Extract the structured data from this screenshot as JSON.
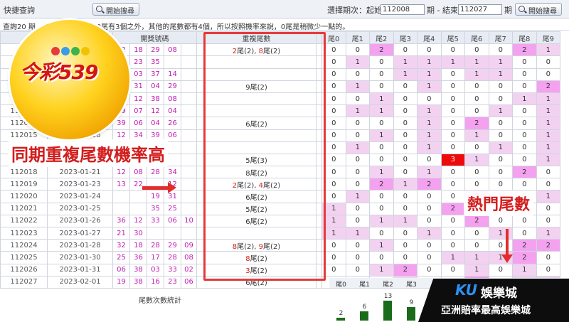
{
  "topbar": {
    "quick_search_label": "快捷查詢",
    "start_search_label": "開始搜尋",
    "period_label_prefix": "選擇期次：起始",
    "start_period": "112008",
    "period_end_label": "期 - 結束",
    "end_period": "112027",
    "period_suffix": "期",
    "start_search_label2": "開始搜尋"
  },
  "note": "查詢20 期，共 39個號碼，除0尾有3個之外，其他的尾數都有4個，所以按照機率來說，0尾是稍微少一點的。",
  "table": {
    "headers": {
      "number": "開獎號碼",
      "repeat": "重複尾數"
    },
    "tail_headers": [
      "尾0",
      "尾1",
      "尾2",
      "尾3",
      "尾4",
      "尾5",
      "尾6",
      "尾7",
      "尾8",
      "尾9"
    ],
    "rows": [
      {
        "id": "",
        "date": "",
        "nums": [
          "02",
          "18",
          "29",
          "08"
        ],
        "rep": [
          [
            "2",
            "尾(2), "
          ],
          [
            "8",
            "尾(2)"
          ]
        ],
        "tails": [
          "0",
          "0",
          "2",
          "0",
          "0",
          "0",
          "0",
          "0",
          "2",
          "1"
        ],
        "shade": [
          "",
          "",
          "pp",
          "",
          "",
          "",
          "",
          "",
          "pp",
          "p"
        ]
      },
      {
        "id": "",
        "date": "",
        "nums": [
          "31",
          "23",
          "35",
          ""
        ],
        "rep": [],
        "tails": [
          "0",
          "1",
          "0",
          "1",
          "1",
          "1",
          "1",
          "1",
          "0",
          "0"
        ],
        "shade": [
          "",
          "p",
          "",
          "p",
          "p",
          "p",
          "p",
          "p",
          "",
          ""
        ]
      },
      {
        "id": "",
        "date": "",
        "nums": [
          "26",
          "03",
          "37",
          "14"
        ],
        "rep": [],
        "tails": [
          "0",
          "0",
          "0",
          "1",
          "1",
          "0",
          "1",
          "1",
          "0",
          "0"
        ],
        "shade": [
          "",
          "",
          "",
          "p",
          "p",
          "",
          "p",
          "p",
          "",
          ""
        ]
      },
      {
        "id": "1",
        "date": "",
        "nums": [
          "09",
          "31",
          "04",
          "29"
        ],
        "rep": [
          [
            "",
            "9尾(2)"
          ]
        ],
        "tails": [
          "0",
          "1",
          "0",
          "0",
          "1",
          "0",
          "0",
          "0",
          "0",
          "2"
        ],
        "shade": [
          "",
          "p",
          "",
          "",
          "p",
          "",
          "",
          "",
          "",
          "pp"
        ]
      },
      {
        "id": "1",
        "date": "",
        "nums": [
          "29",
          "12",
          "38",
          "08"
        ],
        "rep": [],
        "tails": [
          "0",
          "0",
          "1",
          "0",
          "0",
          "0",
          "0",
          "0",
          "1",
          "1"
        ],
        "shade": [
          "",
          "",
          "p",
          "",
          "",
          "",
          "",
          "",
          "p",
          "p"
        ]
      },
      {
        "id": "112013",
        "date": "",
        "nums": [
          "29",
          "07",
          "12",
          "04"
        ],
        "rep": [],
        "tails": [
          "0",
          "1",
          "1",
          "0",
          "1",
          "0",
          "0",
          "1",
          "0",
          "1"
        ],
        "shade": [
          "",
          "p",
          "p",
          "",
          "p",
          "",
          "",
          "p",
          "",
          "p"
        ]
      },
      {
        "id": "112014",
        "date": "2023-01-17",
        "nums": [
          "39",
          "06",
          "04",
          "26"
        ],
        "rep": [
          [
            "",
            "6尾(2)"
          ]
        ],
        "tails": [
          "0",
          "0",
          "0",
          "0",
          "1",
          "0",
          "2",
          "0",
          "0",
          "1"
        ],
        "shade": [
          "",
          "",
          "",
          "",
          "p",
          "",
          "pp",
          "",
          "",
          "p"
        ]
      },
      {
        "id": "112015",
        "date": "2023-01-18",
        "nums": [
          "12",
          "34",
          "39",
          "06"
        ],
        "rep": [],
        "tails": [
          "0",
          "0",
          "1",
          "0",
          "1",
          "0",
          "1",
          "0",
          "0",
          "1"
        ],
        "shade": [
          "",
          "",
          "p",
          "",
          "p",
          "",
          "p",
          "",
          "",
          "p"
        ]
      },
      {
        "id": "",
        "date": "",
        "nums": [
          "",
          "",
          "",
          ""
        ],
        "rep": [],
        "tails": [
          "0",
          "1",
          "0",
          "0",
          "1",
          "0",
          "0",
          "1",
          "0",
          "1"
        ],
        "shade": [
          "",
          "p",
          "",
          "",
          "p",
          "",
          "",
          "p",
          "",
          "p"
        ]
      },
      {
        "id": "",
        "date": "",
        "nums": [
          "",
          "",
          "",
          ""
        ],
        "rep": [
          [
            "",
            "5尾(3)"
          ]
        ],
        "tails": [
          "0",
          "0",
          "0",
          "0",
          "0",
          "3",
          "1",
          "0",
          "0",
          "1"
        ],
        "shade": [
          "",
          "",
          "",
          "",
          "",
          "hot",
          "p",
          "",
          "",
          "p"
        ]
      },
      {
        "id": "112018",
        "date": "2023-01-21",
        "nums": [
          "12",
          "08",
          "28",
          "34"
        ],
        "rep": [
          [
            "",
            "8尾(2)"
          ]
        ],
        "tails": [
          "0",
          "0",
          "1",
          "0",
          "1",
          "0",
          "0",
          "0",
          "2",
          "0"
        ],
        "shade": [
          "",
          "",
          "p",
          "",
          "p",
          "",
          "",
          "",
          "pp",
          ""
        ]
      },
      {
        "id": "112019",
        "date": "2023-01-23",
        "nums": [
          "13",
          "22",
          "",
          "12"
        ],
        "rep": [
          [
            "2",
            "尾(2), "
          ],
          [
            "4",
            "尾(2)"
          ]
        ],
        "tails": [
          "0",
          "0",
          "2",
          "1",
          "2",
          "0",
          "0",
          "0",
          "0",
          "0"
        ],
        "shade": [
          "",
          "",
          "pp",
          "p",
          "pp",
          "",
          "",
          "",
          "",
          ""
        ]
      },
      {
        "id": "112020",
        "date": "2023-01-24",
        "nums": [
          "",
          "",
          "19",
          "31"
        ],
        "rep": [
          [
            "",
            "6尾(2)"
          ]
        ],
        "tails": [
          "0",
          "1",
          "0",
          "0",
          "0",
          "0",
          "2",
          "0",
          "0",
          "1"
        ],
        "shade": [
          "",
          "p",
          "",
          "",
          "",
          "",
          "pp",
          "",
          "",
          "p"
        ]
      },
      {
        "id": "112021",
        "date": "2023-01-25",
        "nums": [
          "",
          "",
          "35",
          "25"
        ],
        "rep": [
          [
            "",
            "5尾(2)"
          ]
        ],
        "tails": [
          "1",
          "0",
          "0",
          "0",
          "0",
          "2",
          "0",
          "1",
          "0",
          "0"
        ],
        "shade": [
          "p",
          "",
          "",
          "",
          "",
          "pp",
          "",
          "p",
          "",
          ""
        ]
      },
      {
        "id": "112022",
        "date": "2023-01-26",
        "nums": [
          "36",
          "12",
          "33",
          "06",
          "10"
        ],
        "rep": [
          [
            "",
            "6尾(2)"
          ]
        ],
        "tails": [
          "1",
          "0",
          "1",
          "1",
          "0",
          "0",
          "2",
          "0",
          "0",
          "0"
        ],
        "shade": [
          "p",
          "",
          "p",
          "p",
          "",
          "",
          "pp",
          "",
          "",
          ""
        ]
      },
      {
        "id": "112023",
        "date": "2023-01-27",
        "nums": [
          "21",
          "30",
          "",
          "",
          ""
        ],
        "rep": [],
        "tails": [
          "1",
          "1",
          "0",
          "0",
          "1",
          "0",
          "0",
          "1",
          "0",
          "1"
        ],
        "shade": [
          "p",
          "p",
          "",
          "",
          "p",
          "",
          "",
          "p",
          "",
          "p"
        ]
      },
      {
        "id": "112024",
        "date": "2023-01-28",
        "nums": [
          "32",
          "18",
          "28",
          "29",
          "09"
        ],
        "rep": [
          [
            "8",
            "尾(2), "
          ],
          [
            "9",
            "尾(2)"
          ]
        ],
        "tails": [
          "0",
          "0",
          "1",
          "0",
          "0",
          "0",
          "0",
          "0",
          "2",
          "2"
        ],
        "shade": [
          "",
          "",
          "p",
          "",
          "",
          "",
          "",
          "",
          "pp",
          "pp"
        ]
      },
      {
        "id": "112025",
        "date": "2023-01-30",
        "nums": [
          "25",
          "36",
          "17",
          "28",
          "08"
        ],
        "rep": [
          [
            "8",
            "尾(2)"
          ]
        ],
        "tails": [
          "0",
          "0",
          "0",
          "0",
          "0",
          "1",
          "1",
          "1",
          "2",
          "0"
        ],
        "shade": [
          "",
          "",
          "",
          "",
          "",
          "p",
          "p",
          "p",
          "pp",
          ""
        ]
      },
      {
        "id": "112026",
        "date": "2023-01-31",
        "nums": [
          "06",
          "38",
          "03",
          "33",
          "02"
        ],
        "rep": [
          [
            "3",
            "尾(2)"
          ]
        ],
        "tails": [
          "0",
          "0",
          "1",
          "2",
          "0",
          "0",
          "1",
          "0",
          "1",
          "0"
        ],
        "shade": [
          "",
          "",
          "p",
          "pp",
          "",
          "",
          "p",
          "",
          "p",
          ""
        ]
      },
      {
        "id": "112027",
        "date": "2023-02-01",
        "nums": [
          "19",
          "38",
          "16",
          "23",
          "06"
        ],
        "rep": [
          [
            "",
            "6尾(2)"
          ]
        ],
        "tails": [
          "0",
          "0",
          "0",
          "1",
          "0",
          "0",
          "2",
          "0",
          "1",
          "1"
        ],
        "shade": [
          "",
          "",
          "",
          "p",
          "",
          "",
          "pp",
          "",
          "p",
          "p"
        ]
      }
    ]
  },
  "stat_label": "尾數次數統計",
  "tail_counts": {
    "labels": [
      "尾0",
      "尾1",
      "尾2",
      "尾3"
    ],
    "values": [
      "2",
      "6",
      "13",
      "9"
    ],
    "levels": [
      2,
      6,
      13,
      9
    ]
  },
  "logo_text": "今彩539",
  "annotation_left": "同期重複尾數機率高",
  "annotation_right": "熱門尾數",
  "watermark": {
    "brand": "KU",
    "brand2": "娛樂城",
    "slogan": "亞洲賠率最高娛樂城"
  }
}
